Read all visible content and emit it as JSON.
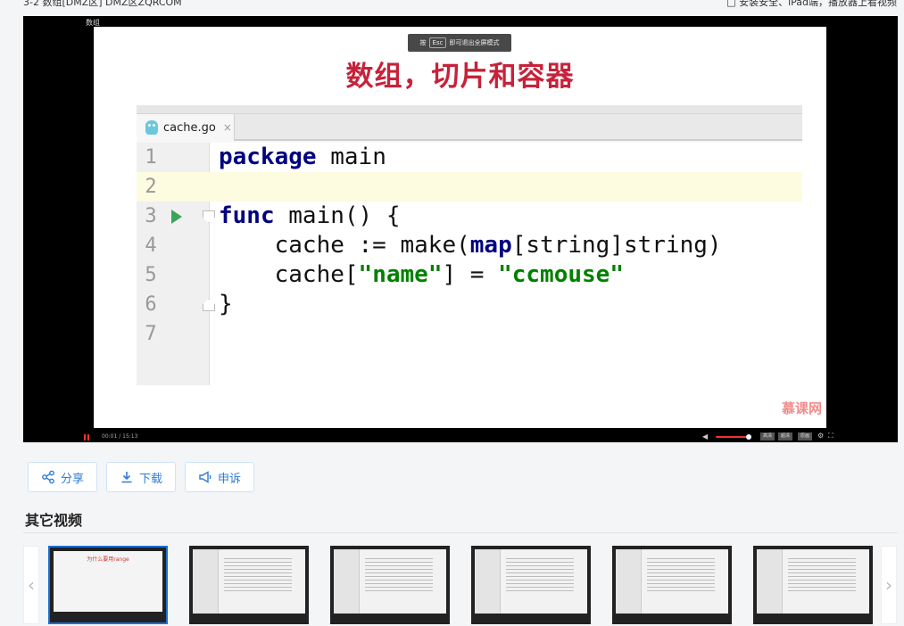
{
  "top": {
    "breadcrumb": "3-2 数组[DMZ区]  DMZ区ZQRCOM",
    "right_text": "□ 安装安全、iPad端，播放器上看视频"
  },
  "player": {
    "title": "数组",
    "esc_tip_prefix": "按",
    "esc_key": "Esc",
    "esc_tip_suffix": "即可退出全屏模式",
    "slide_title": "数组，切片和容器",
    "tab_name": "cache.go",
    "tab_close": "×",
    "watermark": "慕课网",
    "time": "00:01 / 15:13",
    "quality_btns": [
      "高清",
      "超清",
      "原画"
    ],
    "settings_icon": "gear-icon",
    "fullscreen_icon": "fullscreen-icon"
  },
  "code": {
    "lines": [
      "1",
      "2",
      "3",
      "4",
      "5",
      "6",
      "7"
    ],
    "l1_kw": "package",
    "l1_rest": " main",
    "l3_kw": "func",
    "l3_rest": " main() {",
    "l4_a": "    cache := make(",
    "l4_kw": "map",
    "l4_b": "[string]string)",
    "l5_a": "    cache[",
    "l5_s1": "\"name\"",
    "l5_b": "] = ",
    "l5_s2": "\"ccmouse\"",
    "l6": "}"
  },
  "actions": {
    "share": "分享",
    "download": "下载",
    "report": "申诉"
  },
  "other_videos": {
    "title": "其它视频",
    "first_caption": "为什么要用range",
    "prev": "‹",
    "next": "›"
  },
  "colors": {
    "accent": "#2f7bd9",
    "title_red": "#c7223a",
    "keyword": "#000080",
    "string": "#008000"
  }
}
